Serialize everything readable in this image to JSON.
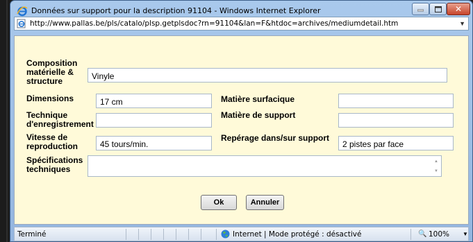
{
  "window": {
    "title": "Données sur support pour la description 91104 - Windows Internet Explorer",
    "url": "http://www.pallas.be/pls/catalo/plsp.getplsdoc?rn=91104&lan=F&htdoc=archives/mediumdetail.htm"
  },
  "form": {
    "composition_label": "Composition matérielle & structure",
    "composition_value": "Vinyle",
    "dimensions_label": "Dimensions",
    "dimensions_value": "17 cm",
    "matiere_surfacique_label": "Matière surfacique",
    "matiere_surfacique_value": "",
    "technique_label": "Technique d'enregistrement",
    "technique_value": "",
    "matiere_support_label": "Matière de support",
    "matiere_support_value": "",
    "vitesse_label": "Vitesse de reproduction",
    "vitesse_value": "45 tours/min.",
    "reperage_label": "Repérage dans/sur support",
    "reperage_value": "2 pistes par face",
    "specifications_label": "Spécifications techniques",
    "specifications_value": ""
  },
  "buttons": {
    "ok": "Ok",
    "annuler": "Annuler"
  },
  "status": {
    "left": "Terminé",
    "zone": "Internet | Mode protégé : désactivé",
    "zoom": "100%"
  },
  "colors": {
    "content_bg": "#fffad9",
    "title_bar": "#a9c9ec",
    "close_button": "#c7442a"
  },
  "icons": {
    "window": "internet-explorer-icon",
    "page": "page-icon",
    "zone": "globe-icon",
    "zoom": "zoom-icon"
  }
}
